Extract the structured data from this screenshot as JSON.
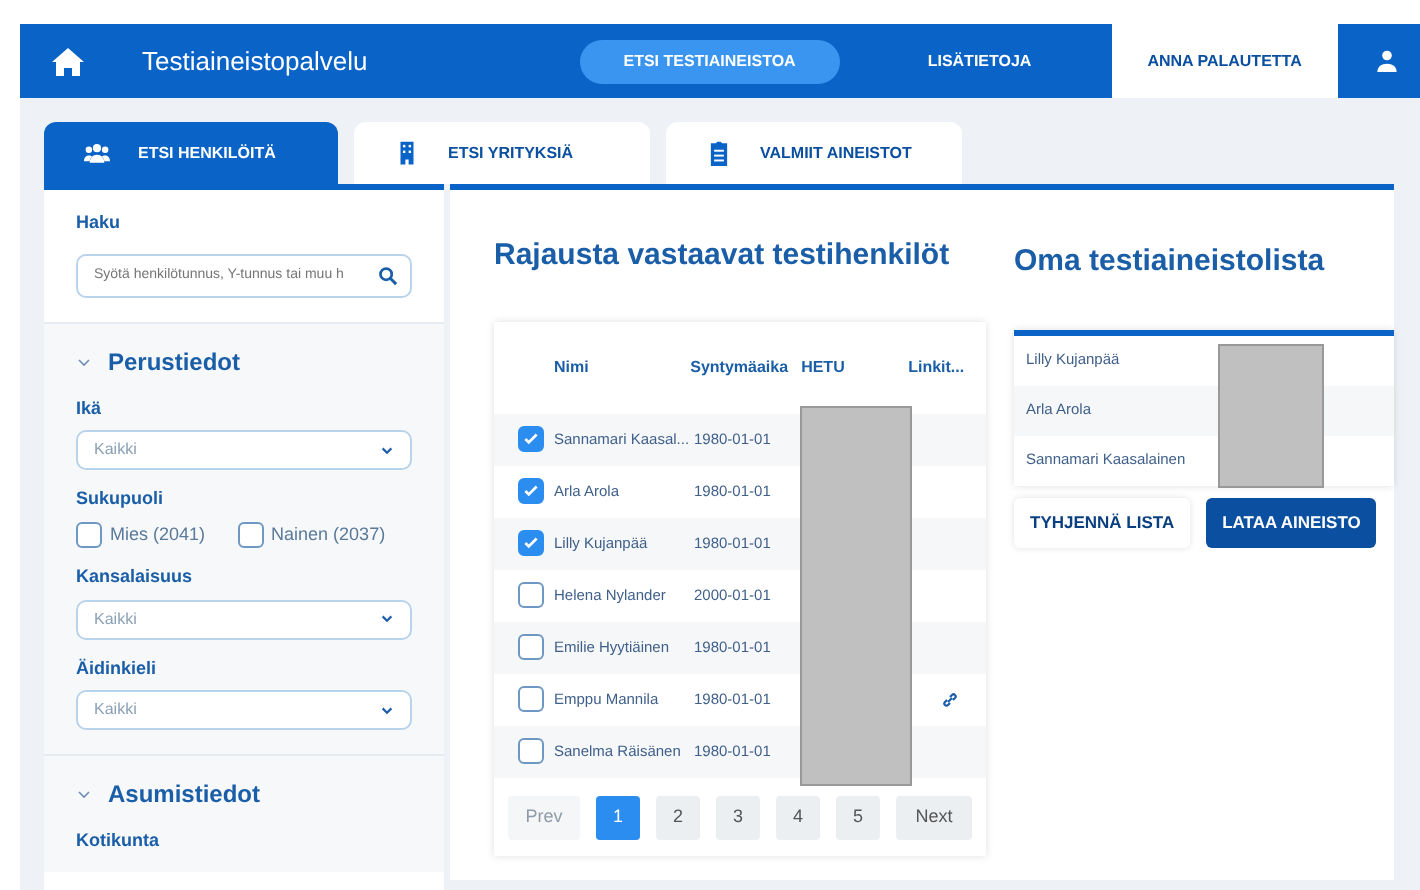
{
  "navbar": {
    "brand": "Testiaineistopalvelu",
    "links": [
      {
        "label": "ETSI TESTIAINEISTOA",
        "kind": "pill"
      },
      {
        "label": "LISÄTIETOJA",
        "kind": "plain"
      },
      {
        "label": "ANNA PALAUTETTA",
        "kind": "light"
      }
    ]
  },
  "tabs": [
    {
      "label": "ETSI HENKILÖITÄ",
      "selected": true
    },
    {
      "label": "ETSI YRITYKSIÄ",
      "selected": false
    },
    {
      "label": "VALMIIT AINEISTOT",
      "selected": false
    }
  ],
  "sidebar": {
    "search": {
      "label": "Haku",
      "placeholder": "Syötä henkilötunnus, Y-tunnus tai muu h"
    },
    "sections": [
      {
        "title": "Perustiedot",
        "expanded": true,
        "fields": [
          {
            "kind": "select",
            "label": "Ikä",
            "value": "Kaikki"
          },
          {
            "kind": "checks",
            "label": "Sukupuoli",
            "options": [
              {
                "label": "Mies (2041)",
                "checked": false
              },
              {
                "label": "Nainen (2037)",
                "checked": false
              }
            ]
          },
          {
            "kind": "select",
            "label": "Kansalaisuus",
            "value": "Kaikki"
          },
          {
            "kind": "select",
            "label": "Äidinkieli",
            "value": "Kaikki"
          }
        ]
      },
      {
        "title": "Asumistiedot",
        "expanded": true,
        "fields": [
          {
            "kind": "label",
            "label": "Kotikunta"
          }
        ]
      }
    ]
  },
  "results": {
    "title": "Rajausta vastaavat testihenkilöt",
    "columns": [
      "Nimi",
      "Syntymäaika",
      "HETU",
      "Linkit..."
    ],
    "rows": [
      {
        "name": "Sannamari Kaasal...",
        "birth": "1980-01-01",
        "checked": true,
        "linked": false
      },
      {
        "name": "Arla Arola",
        "birth": "1980-01-01",
        "checked": true,
        "linked": false
      },
      {
        "name": "Lilly Kujanpää",
        "birth": "1980-01-01",
        "checked": true,
        "linked": false
      },
      {
        "name": "Helena Nylander",
        "birth": "2000-01-01",
        "checked": false,
        "linked": false
      },
      {
        "name": "Emilie Hyytiäinen",
        "birth": "1980-01-01",
        "checked": false,
        "linked": false
      },
      {
        "name": "Emppu Mannila",
        "birth": "1980-01-01",
        "checked": false,
        "linked": true
      },
      {
        "name": "Sanelma Räisänen",
        "birth": "1980-01-01",
        "checked": false,
        "linked": false
      }
    ],
    "pagination": {
      "prev": "Prev",
      "pages": [
        {
          "label": "1",
          "selected": true
        },
        {
          "label": "2",
          "selected": false
        },
        {
          "label": "3",
          "selected": false
        },
        {
          "label": "4",
          "selected": false
        },
        {
          "label": "5",
          "selected": false
        }
      ],
      "next": "Next"
    }
  },
  "own_list": {
    "title": "Oma testiaineistolista",
    "items": [
      "Lilly Kujanpää",
      "Arla Arola",
      "Sannamari Kaasalainen"
    ],
    "buttons": [
      {
        "label": "TYHJENNÄ LISTA",
        "kind": "light"
      },
      {
        "label": "LATAA AINEISTO",
        "kind": "primary"
      }
    ]
  }
}
